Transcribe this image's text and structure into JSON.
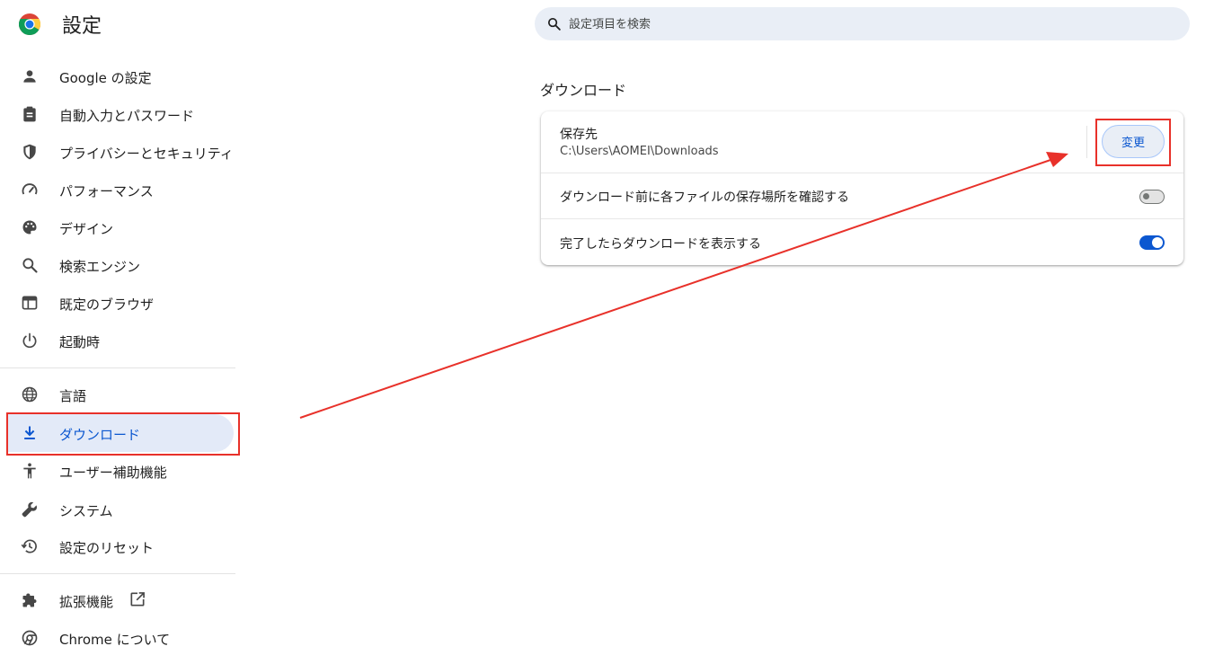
{
  "header": {
    "title": "設定",
    "search_placeholder": "設定項目を検索"
  },
  "sidebar": {
    "items": [
      {
        "label": "Google の設定",
        "icon": "person-icon"
      },
      {
        "label": "自動入力とパスワード",
        "icon": "clipboard-icon"
      },
      {
        "label": "プライバシーとセキュリティ",
        "icon": "shield-icon"
      },
      {
        "label": "パフォーマンス",
        "icon": "speedometer-icon"
      },
      {
        "label": "デザイン",
        "icon": "palette-icon"
      },
      {
        "label": "検索エンジン",
        "icon": "search-icon"
      },
      {
        "label": "既定のブラウザ",
        "icon": "browser-icon"
      },
      {
        "label": "起動時",
        "icon": "power-icon"
      },
      {
        "label": "言語",
        "icon": "globe-icon"
      },
      {
        "label": "ダウンロード",
        "icon": "download-icon",
        "active": true
      },
      {
        "label": "ユーザー補助機能",
        "icon": "accessibility-icon"
      },
      {
        "label": "システム",
        "icon": "wrench-icon"
      },
      {
        "label": "設定のリセット",
        "icon": "history-icon"
      },
      {
        "label": "拡張機能",
        "icon": "puzzle-icon"
      },
      {
        "label": "Chrome について",
        "icon": "chrome-icon"
      }
    ]
  },
  "main": {
    "section_title": "ダウンロード",
    "location_label": "保存先",
    "location_path": "C:\\Users\\AOMEI\\Downloads",
    "change_button": "変更",
    "ask_label": "ダウンロード前に各ファイルの保存場所を確認する",
    "ask_enabled": false,
    "show_label": "完了したらダウンロードを表示する",
    "show_enabled": true
  },
  "colors": {
    "accent": "#0b57d0",
    "active_bg": "#e3eaf8",
    "annotation": "#e8312a"
  }
}
